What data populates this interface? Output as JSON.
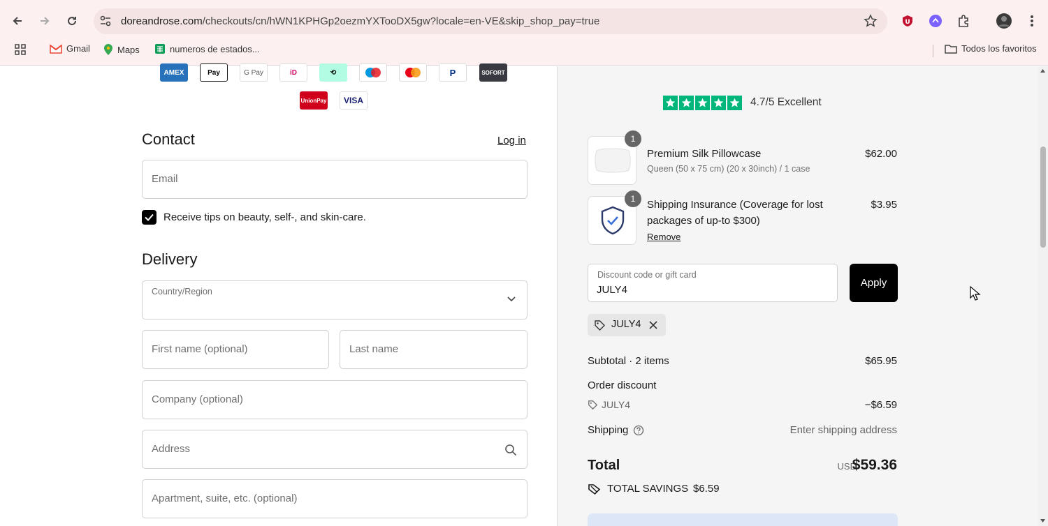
{
  "browser": {
    "url_host": "doreandrose.com",
    "url_path": "/checkouts/cn/hWN1KPHGp2oezmYXTooDX5gw?locale=en-VE&skip_shop_pay=true",
    "bookmarks": [
      {
        "label": "Gmail",
        "icon": "gmail-icon"
      },
      {
        "label": "Maps",
        "icon": "maps-icon"
      },
      {
        "label": "numeros de estados...",
        "icon": "sheets-icon"
      }
    ],
    "all_bookmarks_label": "Todos los favoritos"
  },
  "payment_methods": {
    "row1": [
      "AMEX",
      "Apple Pay",
      "G Pay",
      "iD",
      "Afterpay",
      "Maestro",
      "Mastercard",
      "PayPal",
      "SOFORT"
    ],
    "row2": [
      "UnionPay",
      "VISA"
    ]
  },
  "contact": {
    "title": "Contact",
    "login_label": "Log in",
    "email_placeholder": "Email",
    "marketing_label": "Receive tips on beauty, self-, and skin-care.",
    "marketing_checked": true
  },
  "delivery": {
    "title": "Delivery",
    "country_label": "Country/Region",
    "first_name_placeholder": "First name (optional)",
    "last_name_placeholder": "Last name",
    "company_placeholder": "Company (optional)",
    "address_placeholder": "Address",
    "apartment_placeholder": "Apartment, suite, etc. (optional)"
  },
  "summary": {
    "rating_text": "4.7/5 Excellent",
    "rating_stars": 5,
    "items": [
      {
        "qty": "1",
        "name": "Premium Silk Pillowcase",
        "variant": "Queen (50 x 75 cm) (20 x 30inch) / 1 case",
        "price": "$62.00"
      },
      {
        "qty": "1",
        "name_line1": "Shipping Insurance (Coverage for lost",
        "name_line2": "packages of up-to $300)",
        "price": "$3.95",
        "remove_label": "Remove"
      }
    ],
    "discount_label": "Discount code or gift card",
    "discount_value": "JULY4",
    "apply_label": "Apply",
    "applied_code": "JULY4",
    "subtotal_label": "Subtotal · 2 items",
    "subtotal_value": "$65.95",
    "order_discount_label": "Order discount",
    "order_discount_code": "JULY4",
    "order_discount_value": "−$6.59",
    "shipping_label": "Shipping",
    "shipping_value": "Enter shipping address",
    "total_label": "Total",
    "total_currency": "USD",
    "total_value": "$59.36",
    "savings_label": "TOTAL SAVINGS",
    "savings_value": "$6.59"
  },
  "colors": {
    "trustpilot_green": "#00b67a",
    "apply_bg": "#000000",
    "chrome_bg": "#fdf0f0"
  }
}
